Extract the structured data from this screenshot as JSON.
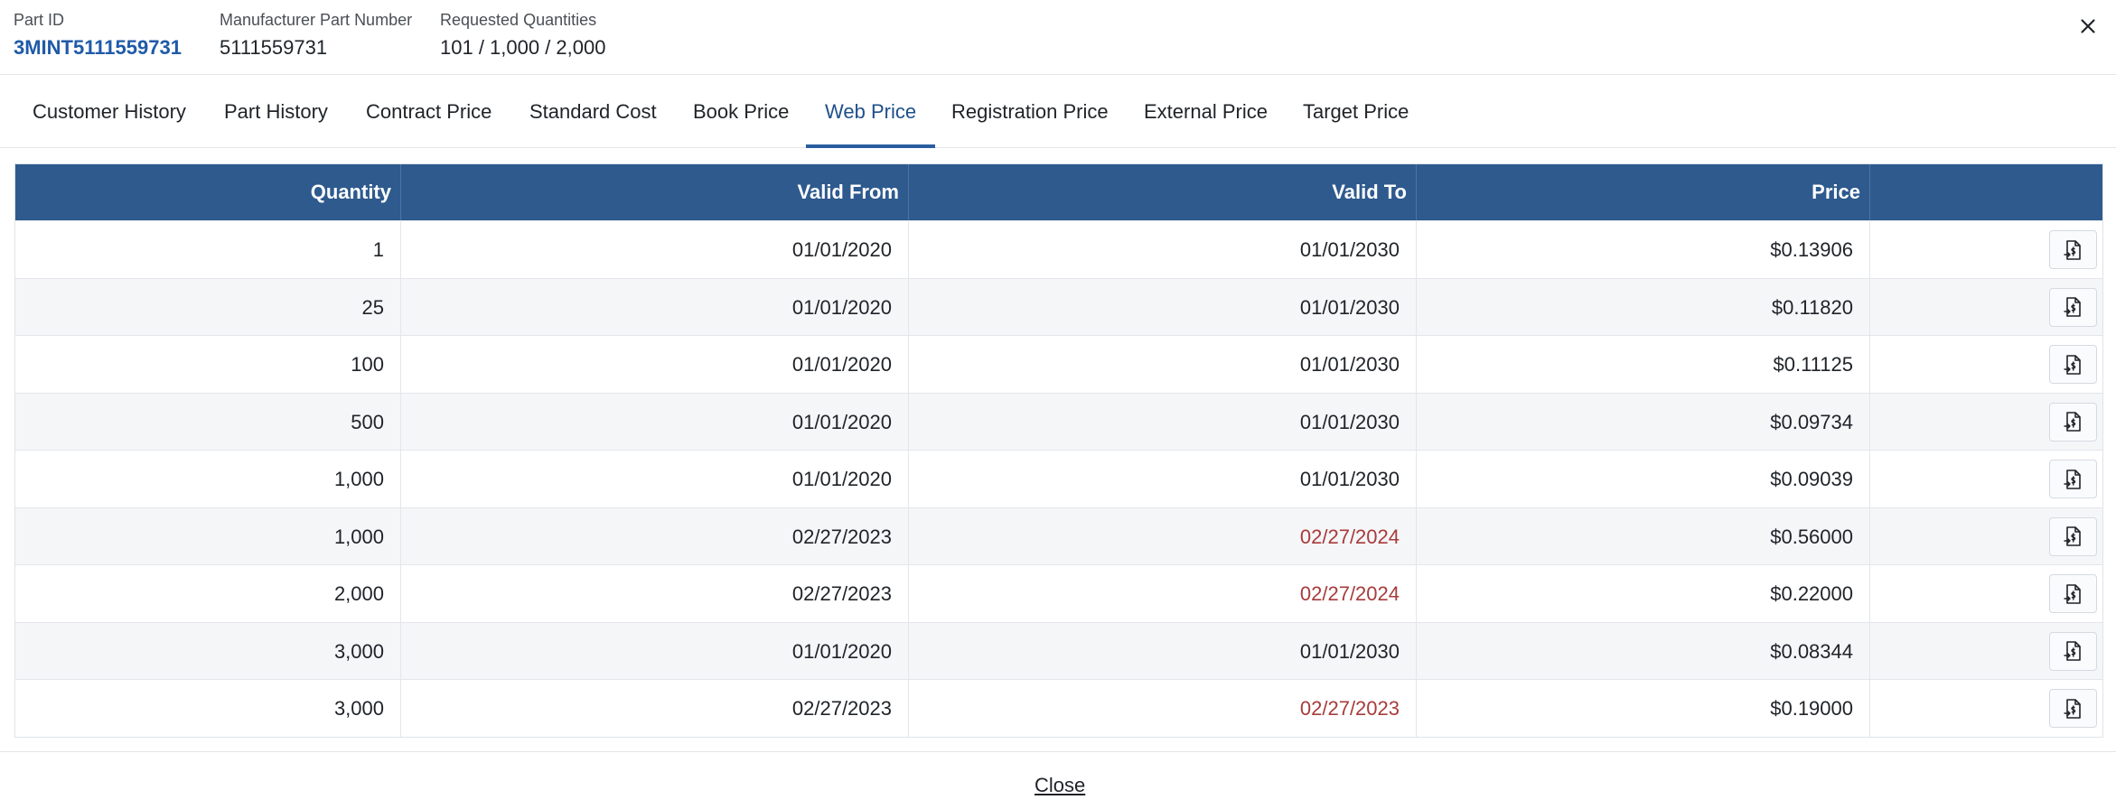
{
  "header": {
    "part_id_label": "Part ID",
    "part_id_value": "3MINT5111559731",
    "mpn_label": "Manufacturer Part Number",
    "mpn_value": "5111559731",
    "req_qty_label": "Requested Quantities",
    "req_qty_value": "101 / 1,000 / 2,000",
    "close_icon": "close-icon"
  },
  "tabs": [
    {
      "label": "Customer History"
    },
    {
      "label": "Part History"
    },
    {
      "label": "Contract Price"
    },
    {
      "label": "Standard Cost"
    },
    {
      "label": "Book Price"
    },
    {
      "label": "Web Price",
      "active": true
    },
    {
      "label": "Registration Price"
    },
    {
      "label": "External Price"
    },
    {
      "label": "Target Price"
    }
  ],
  "table": {
    "columns": [
      "Quantity",
      "Valid From",
      "Valid To",
      "Price"
    ],
    "rows": [
      {
        "quantity": "1",
        "valid_from": "01/01/2020",
        "valid_to": "01/01/2030",
        "price": "$0.13906",
        "expired": false
      },
      {
        "quantity": "25",
        "valid_from": "01/01/2020",
        "valid_to": "01/01/2030",
        "price": "$0.11820",
        "expired": false
      },
      {
        "quantity": "100",
        "valid_from": "01/01/2020",
        "valid_to": "01/01/2030",
        "price": "$0.11125",
        "expired": false
      },
      {
        "quantity": "500",
        "valid_from": "01/01/2020",
        "valid_to": "01/01/2030",
        "price": "$0.09734",
        "expired": false
      },
      {
        "quantity": "1,000",
        "valid_from": "01/01/2020",
        "valid_to": "01/01/2030",
        "price": "$0.09039",
        "expired": false
      },
      {
        "quantity": "1,000",
        "valid_from": "02/27/2023",
        "valid_to": "02/27/2024",
        "price": "$0.56000",
        "expired": true
      },
      {
        "quantity": "2,000",
        "valid_from": "02/27/2023",
        "valid_to": "02/27/2024",
        "price": "$0.22000",
        "expired": true
      },
      {
        "quantity": "3,000",
        "valid_from": "01/01/2020",
        "valid_to": "01/01/2030",
        "price": "$0.08344",
        "expired": false
      },
      {
        "quantity": "3,000",
        "valid_from": "02/27/2023",
        "valid_to": "02/27/2023",
        "price": "$0.19000",
        "expired": true
      }
    ],
    "row_action_icon": "apply-price-icon"
  },
  "footer": {
    "close_label": "Close"
  },
  "colors": {
    "header_bg": "#2e5a8e",
    "accent": "#2a5d9f",
    "link": "#1f5aa8",
    "expired": "#a83b3b"
  }
}
